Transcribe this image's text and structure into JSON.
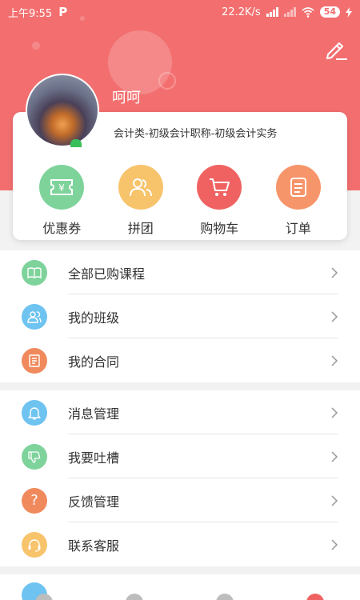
{
  "status": {
    "time": "上午9:55",
    "app_badge": "P",
    "speed": "22.2K/s",
    "battery": "54"
  },
  "profile": {
    "name": "呵呵",
    "course": "会计类-初级会计职称-初级会计实务"
  },
  "actions": [
    {
      "label": "优惠券",
      "icon": "coupon-icon",
      "color": "#7ed39b"
    },
    {
      "label": "拼团",
      "icon": "group-icon",
      "color": "#f7c36b"
    },
    {
      "label": "购物车",
      "icon": "cart-icon",
      "color": "#f06262"
    },
    {
      "label": "订单",
      "icon": "order-icon",
      "color": "#f7956a"
    }
  ],
  "menu_group1": [
    {
      "label": "全部已购课程",
      "icon": "book-icon",
      "color": "#7ed39b"
    },
    {
      "label": "我的班级",
      "icon": "class-icon",
      "color": "#6ec3f0"
    },
    {
      "label": "我的合同",
      "icon": "contract-icon",
      "color": "#f08a5d"
    }
  ],
  "menu_group2": [
    {
      "label": "消息管理",
      "icon": "bell-icon",
      "color": "#6ec3f0"
    },
    {
      "label": "我要吐槽",
      "icon": "thumbs-down-icon",
      "color": "#7ed39b"
    },
    {
      "label": "反馈管理",
      "icon": "question-icon",
      "color": "#f08a5d"
    },
    {
      "label": "联系客服",
      "icon": "headset-icon",
      "color": "#f7c36b"
    }
  ],
  "colors": {
    "header": "#f36f6f",
    "background": "#f2f2f2"
  }
}
